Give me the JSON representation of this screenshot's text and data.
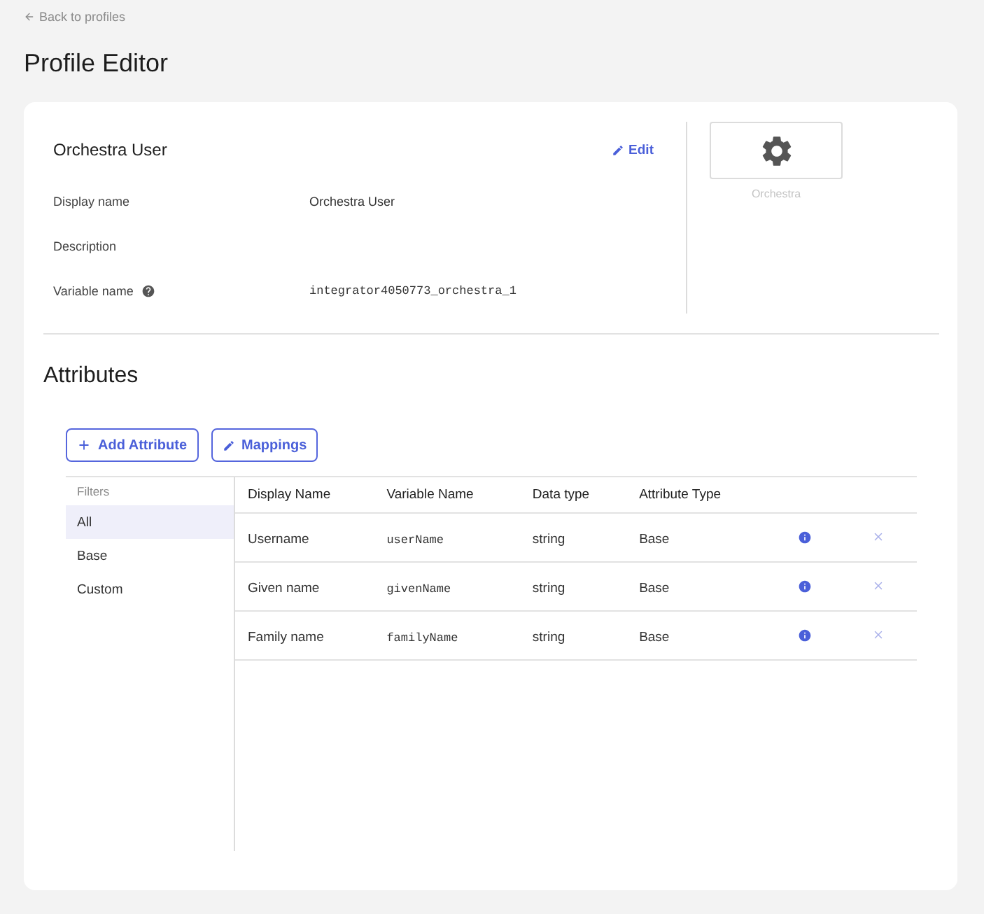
{
  "navigation": {
    "back_link": "Back to profiles"
  },
  "page_title": "Profile Editor",
  "profile": {
    "name": "Orchestra User",
    "edit_link": "Edit",
    "fields": [
      {
        "label": "Display name",
        "value": "Orchestra User",
        "kind": "text",
        "help": false
      },
      {
        "label": "Description",
        "help": false
      },
      {
        "label": "Variable name",
        "value": "integrator4050773_orchestra_1",
        "kind": "code",
        "help": true
      }
    ],
    "image_caption": "Orchestra"
  },
  "attributes": {
    "title": "Attributes",
    "buttons": [
      {
        "label": "Add Attribute",
        "kind": "add"
      },
      {
        "label": "Mappings",
        "kind": "edit"
      }
    ],
    "filters": {
      "title": "Filters",
      "items": [
        {
          "label": "All",
          "selected": true
        },
        {
          "label": "Base",
          "selected": false
        },
        {
          "label": "Custom",
          "selected": false
        }
      ]
    },
    "table": {
      "columns": [
        "Display Name",
        "Variable Name",
        "Data type",
        "Attribute Type"
      ],
      "rows": [
        {
          "display_name": "Username",
          "variable_name": "userName",
          "data_type": "string",
          "attribute_type": "Base"
        },
        {
          "display_name": "Given name",
          "variable_name": "givenName",
          "data_type": "string",
          "attribute_type": "Base"
        },
        {
          "display_name": "Family name",
          "variable_name": "familyName",
          "data_type": "string",
          "attribute_type": "Base"
        }
      ]
    }
  }
}
